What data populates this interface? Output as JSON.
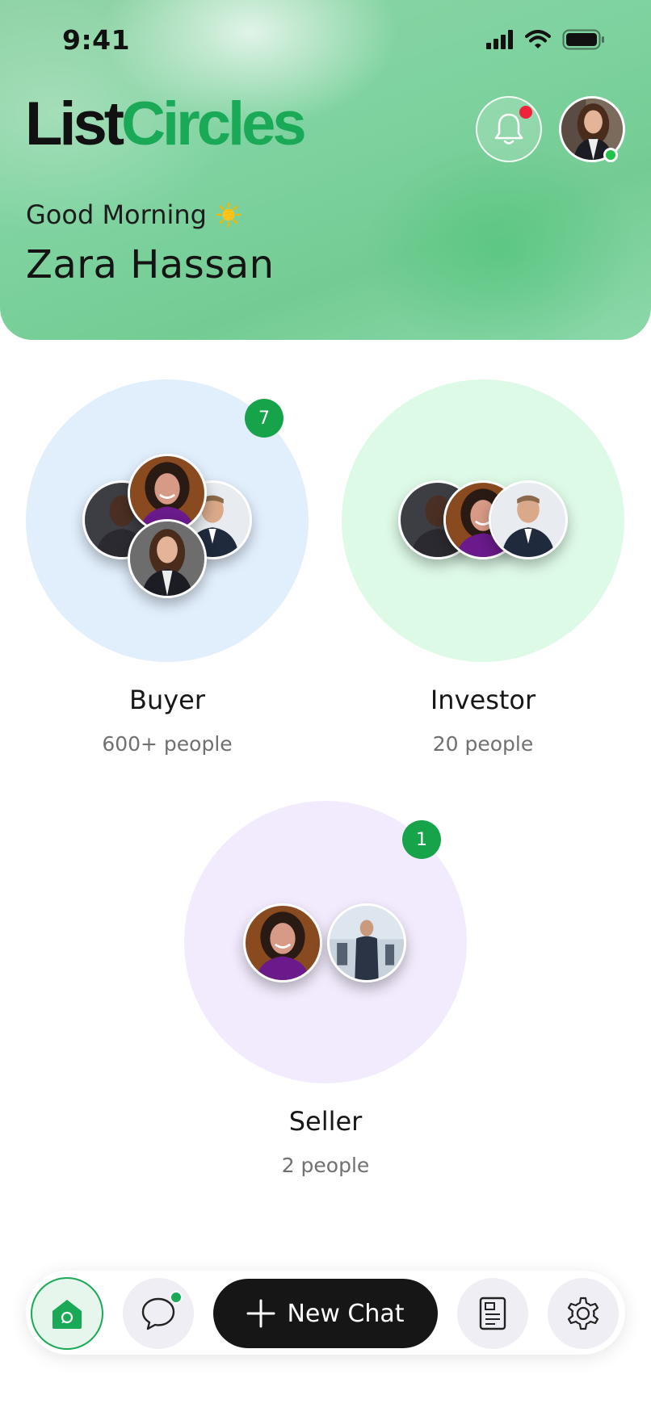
{
  "status_bar": {
    "time": "9:41",
    "icons": [
      "signal-icon",
      "wifi-icon",
      "battery-icon"
    ]
  },
  "header": {
    "logo": {
      "part1": "List",
      "part2": "Circles"
    },
    "greeting": "Good Morning",
    "greeting_emoji": "sun-icon",
    "user_name": "Zara Hassan",
    "notification_dot": true,
    "online": true
  },
  "circles": [
    {
      "title": "Buyer",
      "subtitle": "600+ people",
      "badge": "7",
      "color": "#e1eefc"
    },
    {
      "title": "Investor",
      "subtitle": "20 people",
      "badge": "",
      "color": "#ddfae6"
    },
    {
      "title": "Seller",
      "subtitle": "2 people",
      "badge": "1",
      "color": "#f2ebfd"
    }
  ],
  "nav": {
    "new_chat_label": "New Chat",
    "items": [
      "home-icon",
      "chat-bubble-icon",
      "plus-icon",
      "document-icon",
      "gear-icon"
    ]
  },
  "colors": {
    "brand_green": "#1aa957",
    "badge_green": "#16a34a",
    "notification_red": "#f0213a",
    "dark_button": "#161616"
  }
}
